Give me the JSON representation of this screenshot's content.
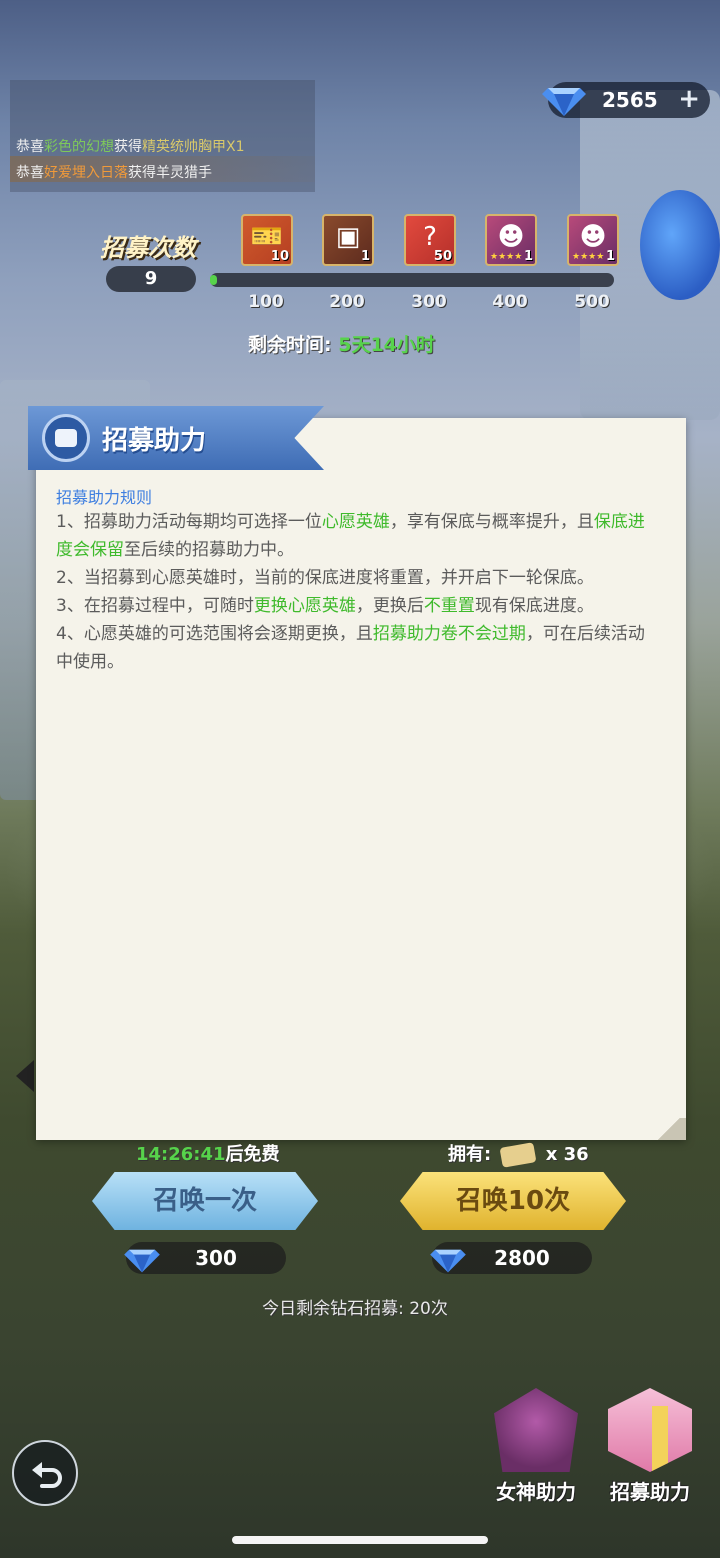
{
  "currency": {
    "diamonds": "2565",
    "plus_label": "+"
  },
  "broadcast": {
    "lines": [
      {
        "prefix": "恭喜",
        "name": "彩色的幻想",
        "mid": "获得",
        "item": "精英统帅胸甲X1"
      },
      {
        "prefix": "恭喜",
        "name": "好爱埋入日落",
        "mid": "获得",
        "item": "羊灵猎手"
      }
    ]
  },
  "recruit_progress": {
    "title": "招募次数",
    "count": "9",
    "progress_percent": 1.8,
    "milestones": [
      "100",
      "200",
      "300",
      "400",
      "500"
    ],
    "rewards": [
      {
        "qty": "10",
        "icon": "ticket-icon"
      },
      {
        "qty": "1",
        "icon": "chest-icon"
      },
      {
        "qty": "50",
        "icon": "mystery-icon"
      },
      {
        "qty": "1",
        "icon": "hero-portrait-icon",
        "stars": "★★★★"
      },
      {
        "qty": "1",
        "icon": "hero-portrait-icon",
        "stars": "★★★★"
      }
    ],
    "remaining_label": "剩余时间:",
    "remaining_value": "5天14小时"
  },
  "modal": {
    "title": "招募助力",
    "rules_heading": "招募助力规则",
    "rules": [
      [
        {
          "t": "1、招募助力活动每期均可选择一位"
        },
        {
          "t": "心愿英雄",
          "hl": true
        },
        {
          "t": "，享有保底与概率提升，且"
        },
        {
          "t": "保底进度会保留",
          "hl": true
        },
        {
          "t": "至后续的招募助力中。"
        }
      ],
      [
        {
          "t": "2、当招募到心愿英雄时，当前的保底进度将重置，并开启下一轮保底。"
        }
      ],
      [
        {
          "t": "3、在招募过程中，可随时"
        },
        {
          "t": "更换心愿英雄",
          "hl": true
        },
        {
          "t": "，更换后"
        },
        {
          "t": "不重置",
          "hl": true
        },
        {
          "t": "现有保底进度。"
        }
      ],
      [
        {
          "t": "4、心愿英雄的可选范围将会逐期更换，且"
        },
        {
          "t": "招募助力卷不会过期",
          "hl": true
        },
        {
          "t": "，可在后续活动中使用。"
        }
      ]
    ]
  },
  "summon": {
    "free_timer": "14:26:41",
    "free_suffix": "后免费",
    "owned_label": "拥有:",
    "owned_count": "x 36",
    "once_label": "召唤一次",
    "ten_label": "召唤10次",
    "once_cost": "300",
    "ten_cost": "2800",
    "daily_limit": "今日剩余钻石招募: 20次"
  },
  "side_buttons": {
    "goddess_label": "女神助力",
    "recruit_help_label": "招募助力"
  },
  "colors": {
    "highlight": "#3fba2c",
    "heading": "#3f7fe0",
    "progress": "#57d34b"
  }
}
